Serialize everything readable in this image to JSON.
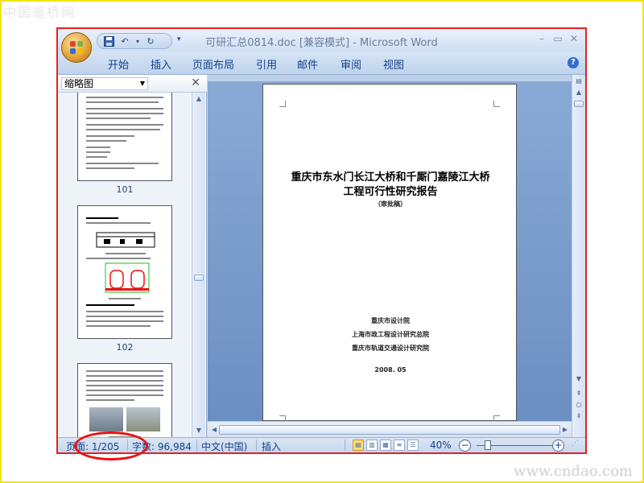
{
  "watermark": {
    "top": "中国道桥网",
    "bottom": "www.cndao.com"
  },
  "window": {
    "title": "可研汇总0814.doc [兼容模式] - Microsoft Word"
  },
  "ribbon": {
    "tabs": [
      "开始",
      "插入",
      "页面布局",
      "引用",
      "邮件",
      "审阅",
      "视图"
    ]
  },
  "thumbnail_pane": {
    "view_label": "缩略图",
    "pages": [
      {
        "number": "101"
      },
      {
        "number": "102"
      }
    ]
  },
  "document": {
    "title_line1": "重庆市东水门长江大桥和千厮门嘉陵江大桥",
    "title_line2": "工程可行性研究报告",
    "subtitle": "（审批稿）",
    "org_line1": "重庆市设计院",
    "org_line2": "上海市政工程设计研究总院",
    "org_line3": "重庆市轨道交通设计研究院",
    "date": "2008. 05"
  },
  "statusbar": {
    "page_label": "页面: 1/205",
    "word_count": "字数: 96,984",
    "language": "中文(中国)",
    "insert_mode": "插入",
    "zoom": "40%"
  },
  "colors": {
    "highlight_circle": "#e11111",
    "window_border": "#e52222",
    "page_frame": "#f5e400"
  }
}
